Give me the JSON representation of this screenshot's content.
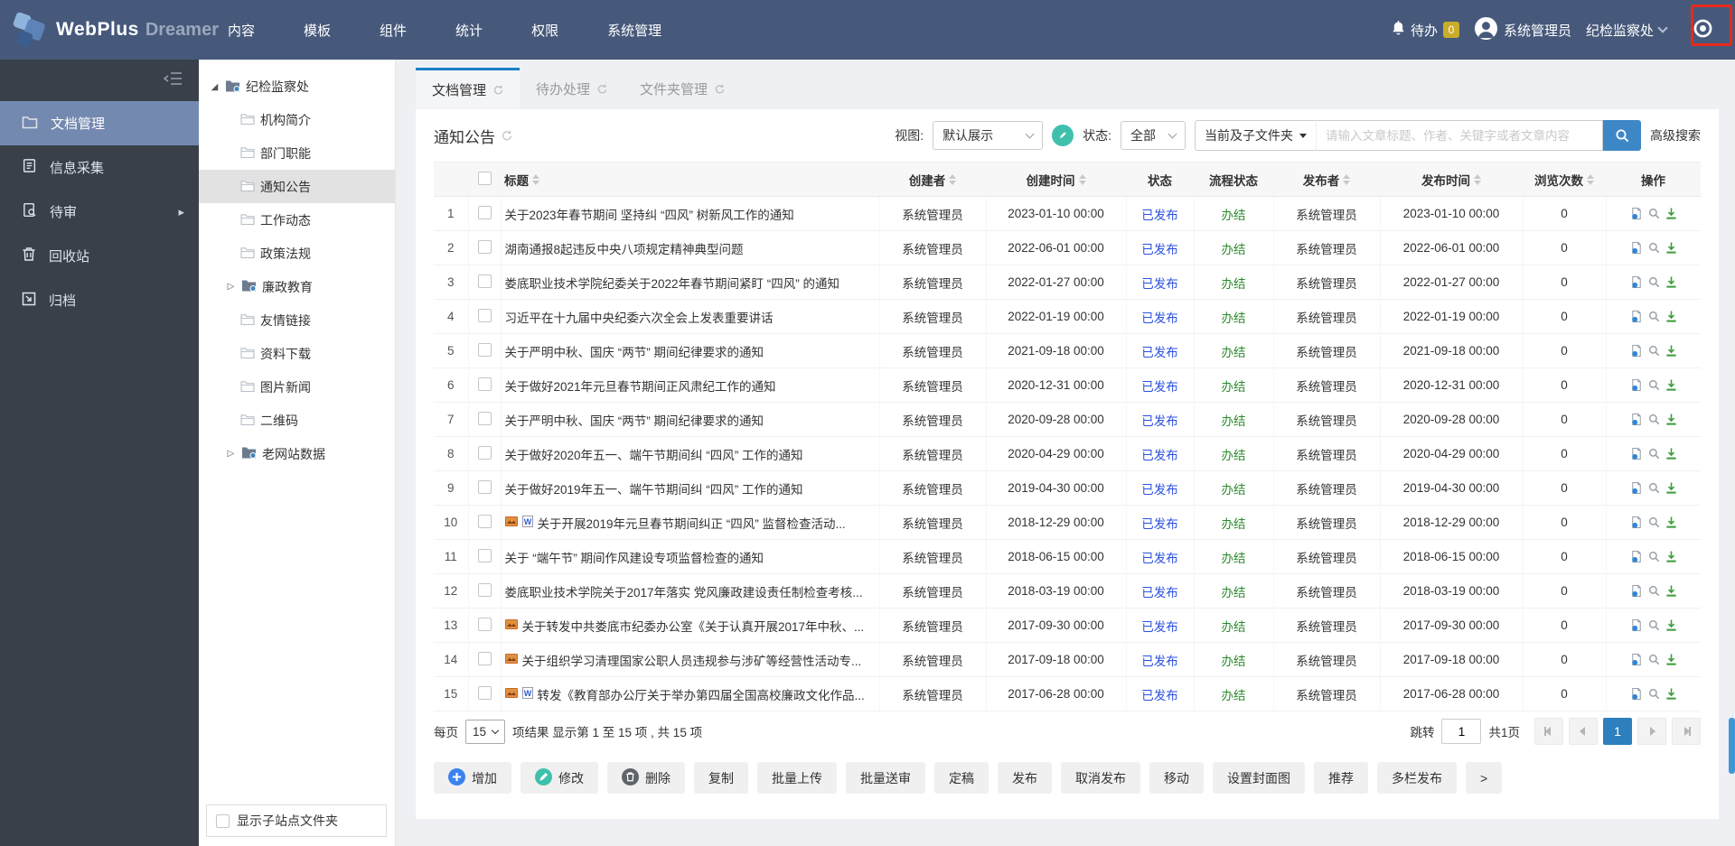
{
  "colors": {
    "topbar": "#46597b",
    "sidebar": "#394049",
    "sidebar_active": "#7489b0",
    "tab_accent": "#1a80c4",
    "search_button": "#3d87c6",
    "status_published": "#2b50e0",
    "flow_done": "#2c8a2c",
    "pager_active": "#2d7fbe",
    "todo_badge": "#c9ac29",
    "annotation_box": "#e8291c"
  },
  "topbar": {
    "brand": "WebPlus",
    "brand_suffix": "Dreamer",
    "menu": [
      "内容",
      "模板",
      "组件",
      "统计",
      "权限",
      "系统管理"
    ],
    "todo": {
      "label": "待办",
      "count": "0"
    },
    "user": "系统管理员",
    "site": "纪检监察处"
  },
  "sidebar": {
    "items": [
      {
        "label": "文档管理",
        "icon": "folder-icon",
        "active": true
      },
      {
        "label": "信息采集",
        "icon": "collect-icon",
        "active": false
      },
      {
        "label": "待审",
        "icon": "review-icon",
        "active": false,
        "has_submenu": true
      },
      {
        "label": "回收站",
        "icon": "trash-icon",
        "active": false
      },
      {
        "label": "归档",
        "icon": "archive-icon",
        "active": false
      }
    ]
  },
  "tree": {
    "root": {
      "label": "纪检监察处",
      "expanded": true
    },
    "children": [
      {
        "label": "机构简介"
      },
      {
        "label": "部门职能"
      },
      {
        "label": "通知公告",
        "selected": true
      },
      {
        "label": "工作动态"
      },
      {
        "label": "政策法规"
      },
      {
        "label": "廉政教育",
        "has_children": true
      },
      {
        "label": "友情链接"
      },
      {
        "label": "资料下载"
      },
      {
        "label": "图片新闻"
      },
      {
        "label": "二维码"
      },
      {
        "label": "老网站数据",
        "has_children": true
      }
    ],
    "footer_checkbox_label": "显示子站点文件夹"
  },
  "tabs": [
    {
      "label": "文档管理",
      "active": true
    },
    {
      "label": "待办处理",
      "active": false
    },
    {
      "label": "文件夹管理",
      "active": false
    }
  ],
  "filter": {
    "folder_title": "通知公告",
    "view_label": "视图:",
    "view_value": "默认展示",
    "status_label": "状态:",
    "status_value": "全部",
    "scope_value": "当前及子文件夹",
    "search_placeholder": "请输入文章标题、作者、关键字或者文章内容",
    "advanced_search": "高级搜索"
  },
  "table": {
    "columns": [
      {
        "label": "标题",
        "sortable": true,
        "key": "title"
      },
      {
        "label": "创建者",
        "sortable": true,
        "key": "creator"
      },
      {
        "label": "创建时间",
        "sortable": true,
        "key": "created"
      },
      {
        "label": "状态",
        "sortable": false,
        "key": "status"
      },
      {
        "label": "流程状态",
        "sortable": false,
        "key": "flow"
      },
      {
        "label": "发布者",
        "sortable": true,
        "key": "publisher"
      },
      {
        "label": "发布时间",
        "sortable": true,
        "key": "published"
      },
      {
        "label": "浏览次数",
        "sortable": true,
        "key": "views"
      },
      {
        "label": "操作",
        "sortable": false,
        "key": "ops"
      }
    ],
    "rows": [
      {
        "num": "1",
        "icons": [],
        "title": "关于2023年春节期间 坚持纠 “四风” 树新风工作的通知",
        "creator": "系统管理员",
        "created": "2023-01-10 00:00",
        "status": "已发布",
        "flow": "办结",
        "publisher": "系统管理员",
        "published": "2023-01-10 00:00",
        "views": "0"
      },
      {
        "num": "2",
        "icons": [],
        "title": "湖南通报8起违反中央八项规定精神典型问题",
        "creator": "系统管理员",
        "created": "2022-06-01 00:00",
        "status": "已发布",
        "flow": "办结",
        "publisher": "系统管理员",
        "published": "2022-06-01 00:00",
        "views": "0"
      },
      {
        "num": "3",
        "icons": [],
        "title": "娄底职业技术学院纪委关于2022年春节期间紧盯 “四风” 的通知",
        "creator": "系统管理员",
        "created": "2022-01-27 00:00",
        "status": "已发布",
        "flow": "办结",
        "publisher": "系统管理员",
        "published": "2022-01-27 00:00",
        "views": "0"
      },
      {
        "num": "4",
        "icons": [],
        "title": "习近平在十九届中央纪委六次全会上发表重要讲话",
        "creator": "系统管理员",
        "created": "2022-01-19 00:00",
        "status": "已发布",
        "flow": "办结",
        "publisher": "系统管理员",
        "published": "2022-01-19 00:00",
        "views": "0"
      },
      {
        "num": "5",
        "icons": [],
        "title": "关于严明中秋、国庆 “两节” 期间纪律要求的通知",
        "creator": "系统管理员",
        "created": "2021-09-18 00:00",
        "status": "已发布",
        "flow": "办结",
        "publisher": "系统管理员",
        "published": "2021-09-18 00:00",
        "views": "0"
      },
      {
        "num": "6",
        "icons": [],
        "title": "关于做好2021年元旦春节期间正风肃纪工作的通知",
        "creator": "系统管理员",
        "created": "2020-12-31 00:00",
        "status": "已发布",
        "flow": "办结",
        "publisher": "系统管理员",
        "published": "2020-12-31 00:00",
        "views": "0"
      },
      {
        "num": "7",
        "icons": [],
        "title": "关于严明中秋、国庆 “两节” 期间纪律要求的通知",
        "creator": "系统管理员",
        "created": "2020-09-28 00:00",
        "status": "已发布",
        "flow": "办结",
        "publisher": "系统管理员",
        "published": "2020-09-28 00:00",
        "views": "0"
      },
      {
        "num": "8",
        "icons": [],
        "title": "关于做好2020年五一、端午节期间纠 “四风” 工作的通知",
        "creator": "系统管理员",
        "created": "2020-04-29 00:00",
        "status": "已发布",
        "flow": "办结",
        "publisher": "系统管理员",
        "published": "2020-04-29 00:00",
        "views": "0"
      },
      {
        "num": "9",
        "icons": [],
        "title": "关于做好2019年五一、端午节期间纠 “四风” 工作的通知",
        "creator": "系统管理员",
        "created": "2019-04-30 00:00",
        "status": "已发布",
        "flow": "办结",
        "publisher": "系统管理员",
        "published": "2019-04-30 00:00",
        "views": "0"
      },
      {
        "num": "10",
        "icons": [
          "image-attachment-icon",
          "word-attachment-icon"
        ],
        "title": "关于开展2019年元旦春节期间纠正 “四风” 监督检查活动...",
        "creator": "系统管理员",
        "created": "2018-12-29 00:00",
        "status": "已发布",
        "flow": "办结",
        "publisher": "系统管理员",
        "published": "2018-12-29 00:00",
        "views": "0"
      },
      {
        "num": "11",
        "icons": [],
        "title": "关于 “端午节” 期间作风建设专项监督检查的通知",
        "creator": "系统管理员",
        "created": "2018-06-15 00:00",
        "status": "已发布",
        "flow": "办结",
        "publisher": "系统管理员",
        "published": "2018-06-15 00:00",
        "views": "0"
      },
      {
        "num": "12",
        "icons": [],
        "title": "娄底职业技术学院关于2017年落实 党风廉政建设责任制检查考核...",
        "creator": "系统管理员",
        "created": "2018-03-19 00:00",
        "status": "已发布",
        "flow": "办结",
        "publisher": "系统管理员",
        "published": "2018-03-19 00:00",
        "views": "0"
      },
      {
        "num": "13",
        "icons": [
          "image-attachment-icon"
        ],
        "title": "关于转发中共娄底市纪委办公室《关于认真开展2017年中秋、...",
        "creator": "系统管理员",
        "created": "2017-09-30 00:00",
        "status": "已发布",
        "flow": "办结",
        "publisher": "系统管理员",
        "published": "2017-09-30 00:00",
        "views": "0"
      },
      {
        "num": "14",
        "icons": [
          "image-attachment-icon"
        ],
        "title": "关于组织学习清理国家公职人员违规参与涉矿等经营性活动专...",
        "creator": "系统管理员",
        "created": "2017-09-18 00:00",
        "status": "已发布",
        "flow": "办结",
        "publisher": "系统管理员",
        "published": "2017-09-18 00:00",
        "views": "0"
      },
      {
        "num": "15",
        "icons": [
          "image-attachment-icon",
          "word-attachment-icon"
        ],
        "title": "转发《教育部办公厅关于举办第四届全国高校廉政文化作品...",
        "creator": "系统管理员",
        "created": "2017-06-28 00:00",
        "status": "已发布",
        "flow": "办结",
        "publisher": "系统管理员",
        "published": "2017-06-28 00:00",
        "views": "0"
      }
    ]
  },
  "pagination": {
    "per_page_label": "每页",
    "per_page_value": "15",
    "result_text": "项结果 显示第 1 至 15 项 , 共 15 项",
    "jump_label": "跳转",
    "jump_value": "1",
    "total_pages_text": "共1页",
    "current_page": "1"
  },
  "toolbar": {
    "buttons": [
      {
        "label": "增加",
        "icon": "plus-circle-icon"
      },
      {
        "label": "修改",
        "icon": "edit-circle-icon"
      },
      {
        "label": "删除",
        "icon": "delete-circle-icon"
      },
      {
        "label": "复制"
      },
      {
        "label": "批量上传"
      },
      {
        "label": "批量送审"
      },
      {
        "label": "定稿"
      },
      {
        "label": "发布"
      },
      {
        "label": "取消发布"
      },
      {
        "label": "移动"
      },
      {
        "label": "设置封面图"
      },
      {
        "label": "推荐"
      },
      {
        "label": "多栏发布"
      },
      {
        "label": ">"
      }
    ]
  }
}
